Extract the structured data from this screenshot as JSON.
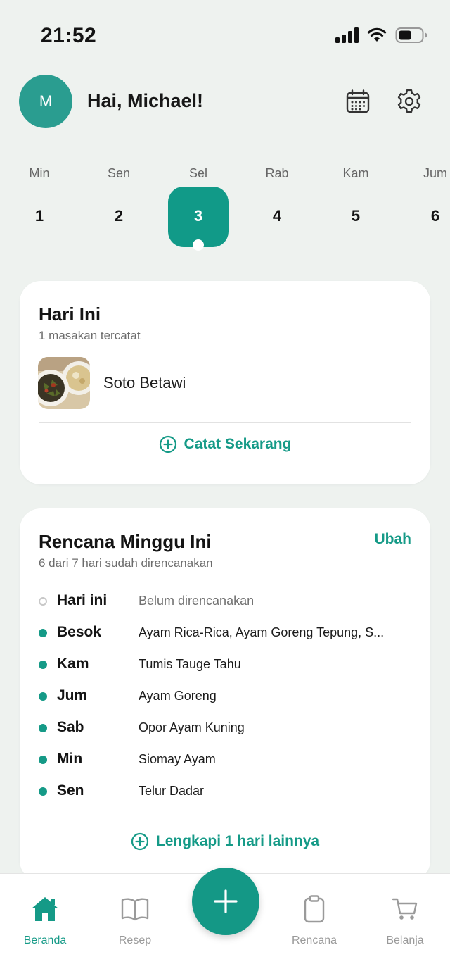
{
  "status_bar": {
    "time": "21:52"
  },
  "header": {
    "avatar_initial": "M",
    "greeting": "Hai, Michael!"
  },
  "week": {
    "days": [
      {
        "name": "Min",
        "num": "1"
      },
      {
        "name": "Sen",
        "num": "2"
      },
      {
        "name": "Sel",
        "num": "3"
      },
      {
        "name": "Rab",
        "num": "4"
      },
      {
        "name": "Kam",
        "num": "5"
      },
      {
        "name": "Jum",
        "num": "6"
      }
    ],
    "selected_index": 2
  },
  "today_card": {
    "title": "Hari Ini",
    "subtitle": "1 masakan tercatat",
    "meals": [
      {
        "name": "Soto Betawi"
      }
    ],
    "action_label": "Catat Sekarang"
  },
  "plan_card": {
    "title": "Rencana Minggu Ini",
    "edit_label": "Ubah",
    "subtitle": "6 dari 7 hari sudah direncanakan",
    "rows": [
      {
        "day": "Hari ini",
        "meal": "Belum direncanakan",
        "planned": false
      },
      {
        "day": "Besok",
        "meal": "Ayam Rica-Rica, Ayam Goreng Tepung, S...",
        "planned": true
      },
      {
        "day": "Kam",
        "meal": "Tumis Tauge Tahu",
        "planned": true
      },
      {
        "day": "Jum",
        "meal": "Ayam Goreng",
        "planned": true
      },
      {
        "day": "Sab",
        "meal": "Opor Ayam Kuning",
        "planned": true
      },
      {
        "day": "Min",
        "meal": "Siomay Ayam",
        "planned": true
      },
      {
        "day": "Sen",
        "meal": "Telur Dadar",
        "planned": true
      }
    ],
    "action_label": "Lengkapi 1 hari lainnya"
  },
  "tabbar": {
    "tabs": [
      {
        "label": "Beranda",
        "icon": "home-icon",
        "active": true
      },
      {
        "label": "Resep",
        "icon": "book-icon",
        "active": false
      },
      {
        "label": "Rencana",
        "icon": "clipboard-icon",
        "active": false
      },
      {
        "label": "Belanja",
        "icon": "cart-icon",
        "active": false
      }
    ],
    "fab_icon": "plus-icon"
  },
  "colors": {
    "accent": "#159a87",
    "background": "#eef2ef",
    "card": "#ffffff"
  }
}
